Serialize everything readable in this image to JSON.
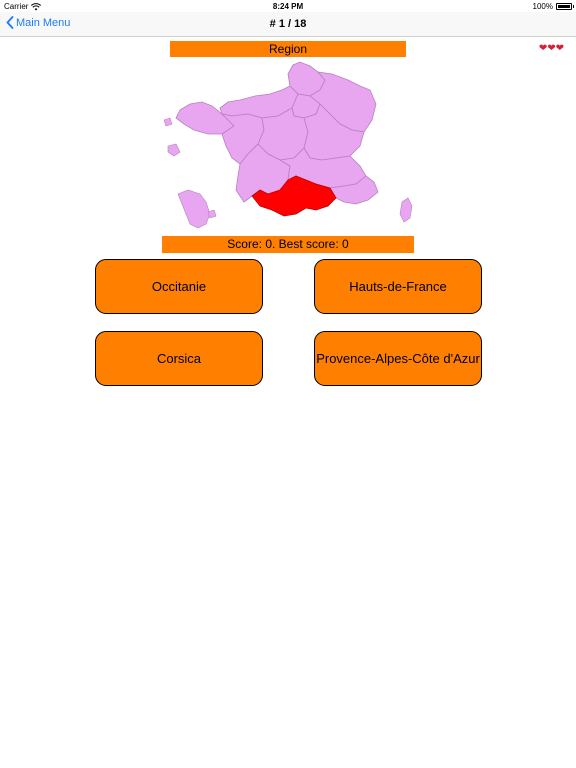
{
  "status_bar": {
    "carrier": "Carrier",
    "time": "8:24 PM",
    "battery": "100%",
    "battery_level": 1.0
  },
  "nav": {
    "back_label": "Main Menu",
    "title": "# 1 / 18"
  },
  "quiz": {
    "prompt": "Region",
    "lives": 3,
    "score_text": "Score: 0. Best score: 0",
    "answers": [
      {
        "label": "Occitanie"
      },
      {
        "label": "Hauts-de-France"
      },
      {
        "label": "Corsica"
      },
      {
        "label": "Provence-Alpes-Côte d'Azur"
      }
    ]
  },
  "colors": {
    "accent": "#ff8000",
    "map_fill": "#e9a6f0",
    "map_border": "#b77fc0",
    "highlight": "#ff0000",
    "link": "#1a7cf5",
    "heart": "#d4203a"
  },
  "icons": {
    "back": "chevron-left-icon",
    "wifi": "wifi-icon",
    "battery": "battery-icon",
    "lives": "heart-icon"
  }
}
